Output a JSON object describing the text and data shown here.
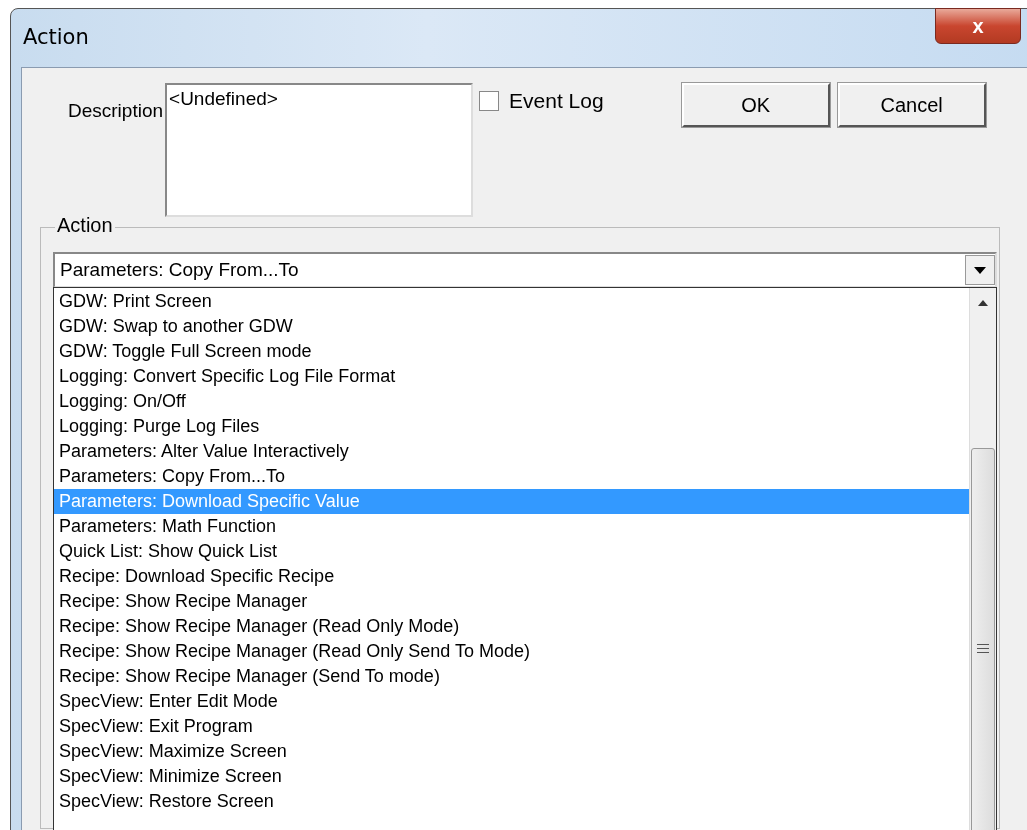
{
  "window": {
    "title": "Action",
    "close": "x"
  },
  "description": {
    "label": "Description",
    "value": "<Undefined>"
  },
  "event_log": {
    "label": "Event Log",
    "checked": false
  },
  "buttons": [
    "OK",
    "Cancel"
  ],
  "action_group": {
    "label": "Action",
    "combo_value": "Parameters: Copy From...To",
    "items": [
      {
        "label": "GDW: Print Screen",
        "selected": false
      },
      {
        "label": "GDW: Swap to another GDW",
        "selected": false
      },
      {
        "label": "GDW: Toggle Full Screen mode",
        "selected": false
      },
      {
        "label": "Logging: Convert Specific Log File Format",
        "selected": false
      },
      {
        "label": "Logging: On/Off",
        "selected": false
      },
      {
        "label": "Logging: Purge Log Files",
        "selected": false
      },
      {
        "label": "Parameters: Alter Value Interactively",
        "selected": false
      },
      {
        "label": "Parameters: Copy From...To",
        "selected": false
      },
      {
        "label": "Parameters: Download Specific Value",
        "selected": true
      },
      {
        "label": "Parameters: Math Function",
        "selected": false
      },
      {
        "label": "Quick List: Show Quick List",
        "selected": false
      },
      {
        "label": "Recipe: Download Specific Recipe",
        "selected": false
      },
      {
        "label": "Recipe: Show Recipe Manager",
        "selected": false
      },
      {
        "label": "Recipe: Show Recipe Manager (Read Only Mode)",
        "selected": false
      },
      {
        "label": "Recipe: Show Recipe Manager (Read Only Send To Mode)",
        "selected": false
      },
      {
        "label": "Recipe: Show Recipe Manager (Send To mode)",
        "selected": false
      },
      {
        "label": "SpecView: Enter Edit Mode",
        "selected": false
      },
      {
        "label": "SpecView: Exit Program",
        "selected": false
      },
      {
        "label": "SpecView: Maximize Screen",
        "selected": false
      },
      {
        "label": "SpecView: Minimize Screen",
        "selected": false
      },
      {
        "label": "SpecView: Restore Screen",
        "selected": false
      }
    ]
  }
}
